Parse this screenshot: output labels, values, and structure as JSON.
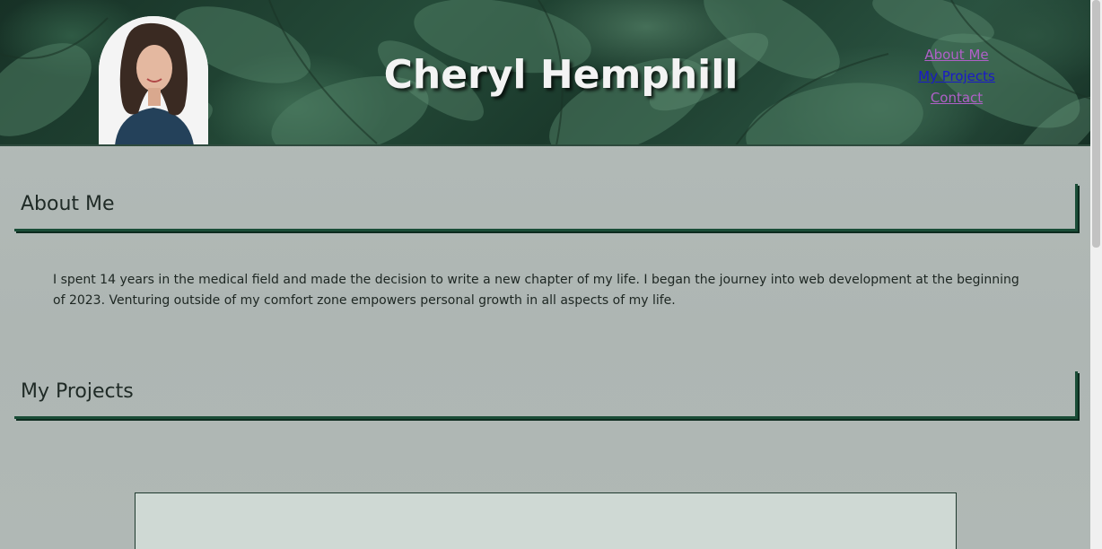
{
  "header": {
    "title": "Cheryl Hemphill",
    "nav": [
      {
        "label": "About Me",
        "state": "visited"
      },
      {
        "label": "My Projects",
        "state": "link"
      },
      {
        "label": "Contact",
        "state": "visited"
      }
    ]
  },
  "about": {
    "heading": "About Me",
    "text": "I spent 14 years in the medical field and made the decision to write a new chapter of my life. I began the journey into web development at the beginning of 2023. Venturing outside of my comfort zone empowers personal growth in all aspects of my life."
  },
  "projects": {
    "heading": "My Projects"
  },
  "colors": {
    "accent": "#1a4d37",
    "background": "#b4bcb9",
    "visited_link": "#b060c8",
    "link": "#1a1ac8",
    "card": "#cfd9d4"
  }
}
